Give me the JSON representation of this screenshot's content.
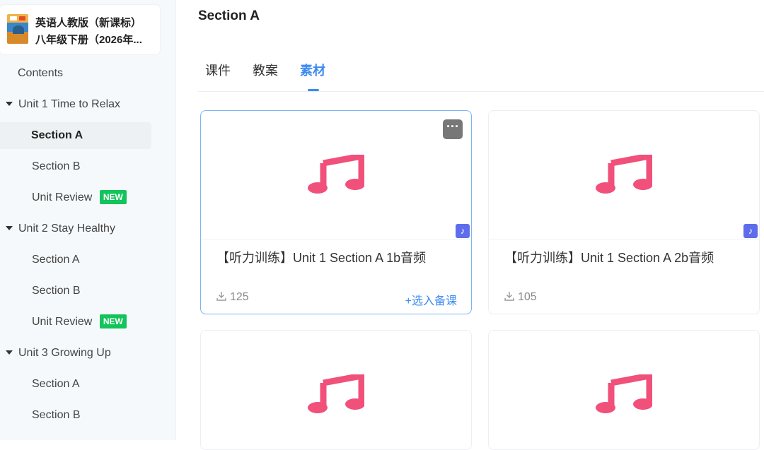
{
  "sidebar": {
    "book": {
      "title_line1": "英语人教版（新课标）",
      "title_line2": "八年级下册（2026年..."
    },
    "contents_label": "Contents",
    "units": [
      {
        "label": "Unit 1 Time to Relax",
        "sections": [
          {
            "label": "Section A",
            "active": true
          },
          {
            "label": "Section B"
          },
          {
            "label": "Unit Review",
            "badge": "NEW"
          }
        ]
      },
      {
        "label": "Unit 2 Stay Healthy",
        "sections": [
          {
            "label": "Section A"
          },
          {
            "label": "Section B"
          },
          {
            "label": "Unit Review",
            "badge": "NEW"
          }
        ]
      },
      {
        "label": "Unit 3 Growing Up",
        "sections": [
          {
            "label": "Section A"
          },
          {
            "label": "Section B"
          }
        ]
      }
    ]
  },
  "main": {
    "title": "Section A",
    "tabs": [
      {
        "label": "课件"
      },
      {
        "label": "教案"
      },
      {
        "label": "素材",
        "active": true
      }
    ],
    "cards": [
      {
        "title": "【听力训练】Unit 1 Section A 1b音频",
        "downloads": "125",
        "add_label": "+选入备课",
        "more_label": "···",
        "type_icon": "music-note-icon"
      },
      {
        "title": "【听力训练】Unit 1 Section A 2b音频",
        "downloads": "105",
        "type_icon": "music-note-icon"
      },
      {
        "title": "",
        "type_icon": "music-note-icon"
      },
      {
        "title": "",
        "type_icon": "music-note-icon"
      }
    ]
  },
  "colors": {
    "accent": "#3d8bf2",
    "new_badge": "#13c35c",
    "music_note": "#f0507a",
    "type_badge": "#5e6dec"
  }
}
